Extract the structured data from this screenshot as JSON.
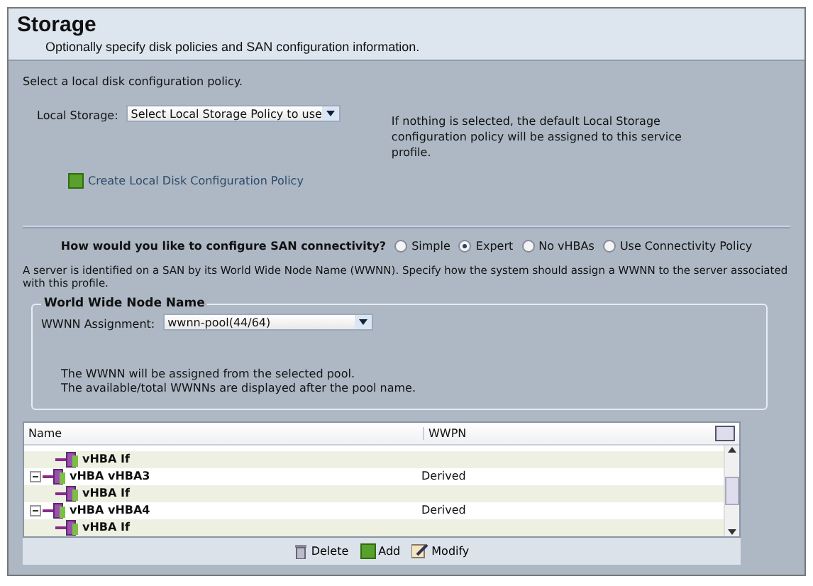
{
  "header": {
    "title": "Storage",
    "subtitle": "Optionally specify disk policies and SAN configuration information."
  },
  "local_storage": {
    "intro": "Select a local disk configuration policy.",
    "label": "Local Storage:",
    "value": "Select Local Storage Policy to use",
    "note": "If nothing is selected, the default Local Storage configuration policy will be assigned to this service profile.",
    "create_link": "Create Local Disk Configuration Policy"
  },
  "san": {
    "question": "How would you like to configure SAN connectivity?",
    "options": [
      {
        "label": "Simple",
        "selected": false
      },
      {
        "label": "Expert",
        "selected": true
      },
      {
        "label": "No vHBAs",
        "selected": false
      },
      {
        "label": "Use Connectivity Policy",
        "selected": false
      }
    ],
    "description": "A server is identified on a SAN by its World Wide Node Name (WWNN). Specify how the system should assign a WWNN to the server associated with this profile."
  },
  "wwnn": {
    "legend": "World Wide Node Name",
    "label": "WWNN Assignment:",
    "value": "wwnn-pool(44/64)",
    "notes": [
      "The WWNN will be assigned from the selected pool.",
      "The available/total WWNNs are displayed after the pool name."
    ]
  },
  "table": {
    "columns": [
      "Name",
      "WWPN"
    ],
    "rows": [
      {
        "children": [
          {
            "name": "vHBA If"
          }
        ]
      },
      {
        "name": "vHBA vHBA3",
        "wwpn": "Derived",
        "expanded": true,
        "children": [
          {
            "name": "vHBA If"
          }
        ]
      },
      {
        "name": "vHBA vHBA4",
        "wwpn": "Derived",
        "expanded": true,
        "children": [
          {
            "name": "vHBA If"
          }
        ]
      }
    ]
  },
  "actions": [
    "Delete",
    "Add",
    "Modify"
  ]
}
